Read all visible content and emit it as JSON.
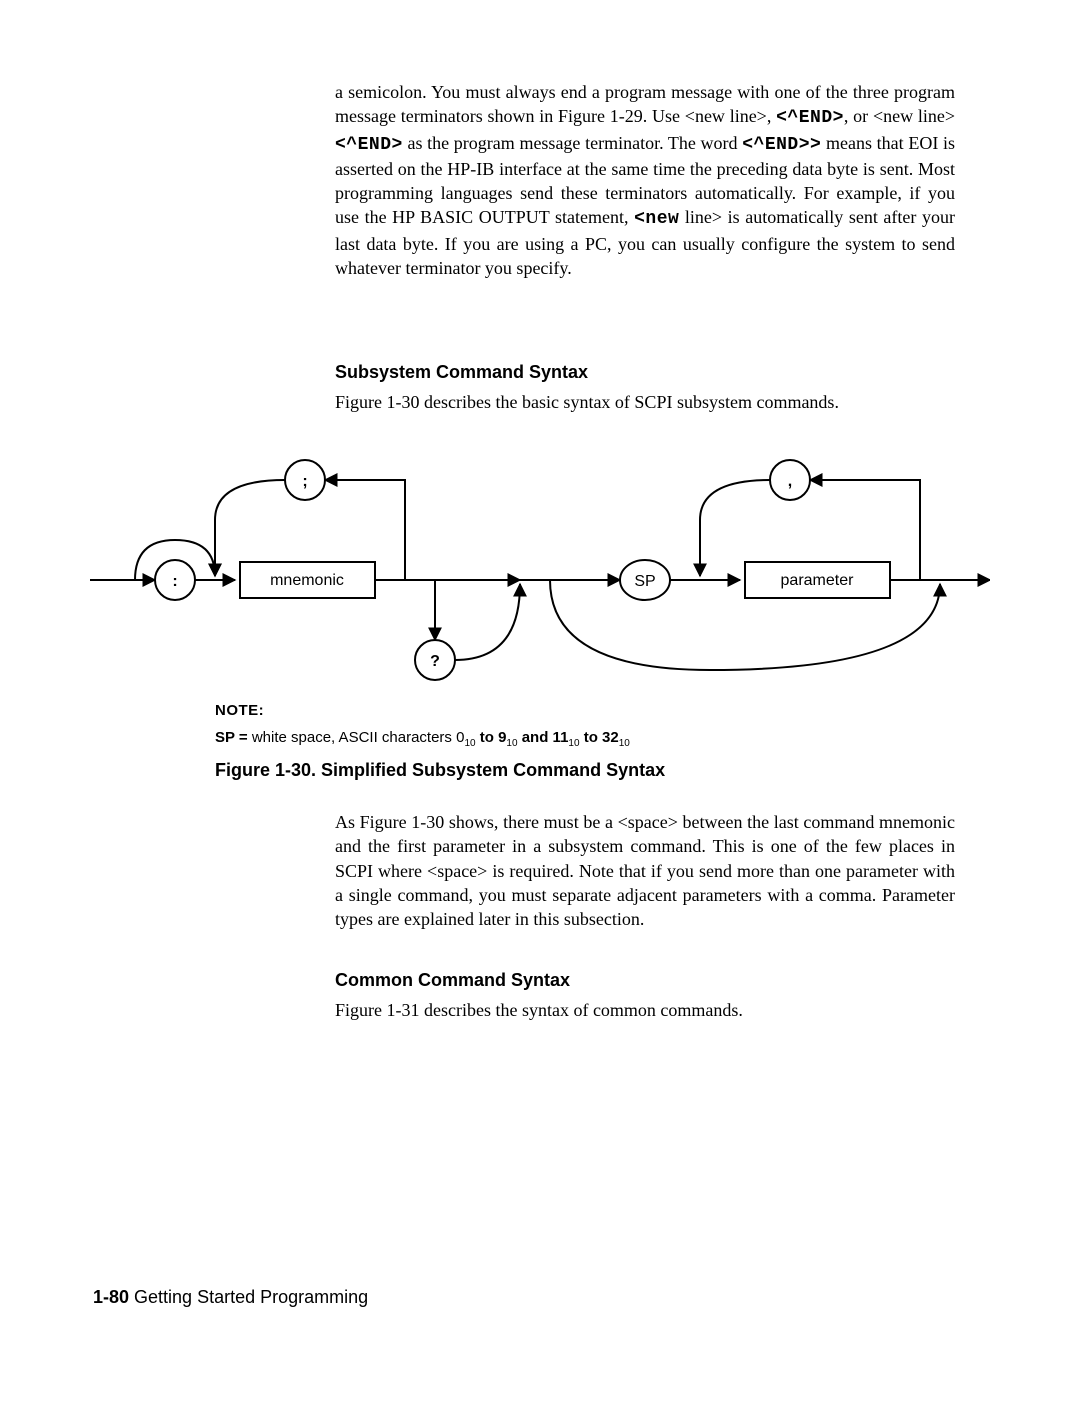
{
  "para1": {
    "seg1": "a semicolon. You must always end a program message with one of the three program message terminators shown in Figure 1-29. Use <new line>, ",
    "code1": "<^END>",
    "seg2": ", or <new line> ",
    "code2": "<^END>",
    "seg3": " as the program message terminator. The word ",
    "code3": "<^END>>",
    "seg4": " means that EOI is asserted on the HP-IB interface at the same time the preceding data byte is sent. Most programming languages send these terminators automatically. For example, if you use the HP BASIC OUTPUT statement, ",
    "code4": "<new",
    "seg5": " line> is automatically sent after your last data byte. If you are using a PC, you can usually configure the system to send whatever terminator you specify."
  },
  "heading1": "Subsystem Command Syntax",
  "para2": "Figure 1-30 describes the basic syntax of SCPI subsystem commands.",
  "diagram": {
    "mnemonic": "mnemonic",
    "sp": "SP",
    "parameter": "parameter",
    "colon": ":",
    "semicolon": ";",
    "comma": ",",
    "qmark": "?"
  },
  "note": {
    "label": "NOTE:",
    "sp_eq": "SP  =",
    "sp_text1": "  white  space,  ASCII  characters  0",
    "sp_to1": " to  9",
    "sp_and": " and  11",
    "sp_to2": " to  32",
    "sub": "10"
  },
  "fig_caption": "Figure 1-30. Simplified Subsystem Command Syntax",
  "para3": "As Figure 1-30 shows, there must be a <space> between the last command mnemonic and the first parameter in a subsystem command. This is one of the few places in SCPI where <space> is required. Note that if you send more than one parameter with a single command, you must separate adjacent parameters with a comma. Parameter types are explained later in this subsection.",
  "heading2": "Common Command Syntax",
  "para4": "Figure 1-31 describes the syntax of common commands.",
  "footer": {
    "page": "1-80",
    "title": " Getting Started Programming"
  }
}
